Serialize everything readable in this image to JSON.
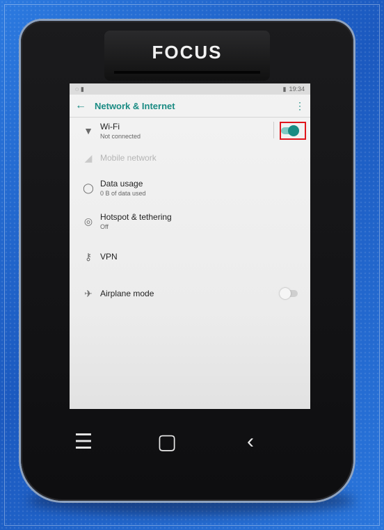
{
  "device": {
    "logo": "FOCUS"
  },
  "statusbar": {
    "time": "19:34"
  },
  "appbar": {
    "title": "Network & Internet"
  },
  "settings": {
    "wifi": {
      "label": "Wi-Fi",
      "status": "Not connected",
      "enabled": true
    },
    "mobile_network": {
      "label": "Mobile network"
    },
    "data_usage": {
      "label": "Data usage",
      "status": "0 B of data used"
    },
    "hotspot": {
      "label": "Hotspot & tethering",
      "status": "Off"
    },
    "vpn": {
      "label": "VPN"
    },
    "airplane": {
      "label": "Airplane mode",
      "enabled": false
    }
  },
  "colors": {
    "accent": "#1a8b83",
    "highlight": "#e0151b"
  }
}
